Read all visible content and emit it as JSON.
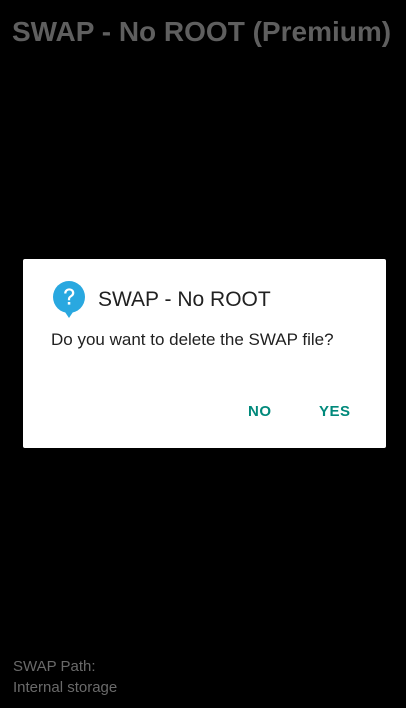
{
  "app": {
    "title": "SWAP - No ROOT (Premium)"
  },
  "dialog": {
    "icon": "question-bubble-icon",
    "title": "SWAP - No ROOT",
    "message": "Do you want to delete the SWAP file?",
    "no_label": "NO",
    "yes_label": "YES"
  },
  "footer": {
    "path_label": "SWAP Path:",
    "path_value": "Internal storage"
  },
  "colors": {
    "accent": "#00897b",
    "icon_blue": "#29a8e0",
    "background": "#000000",
    "dialog_bg": "#ffffff"
  }
}
